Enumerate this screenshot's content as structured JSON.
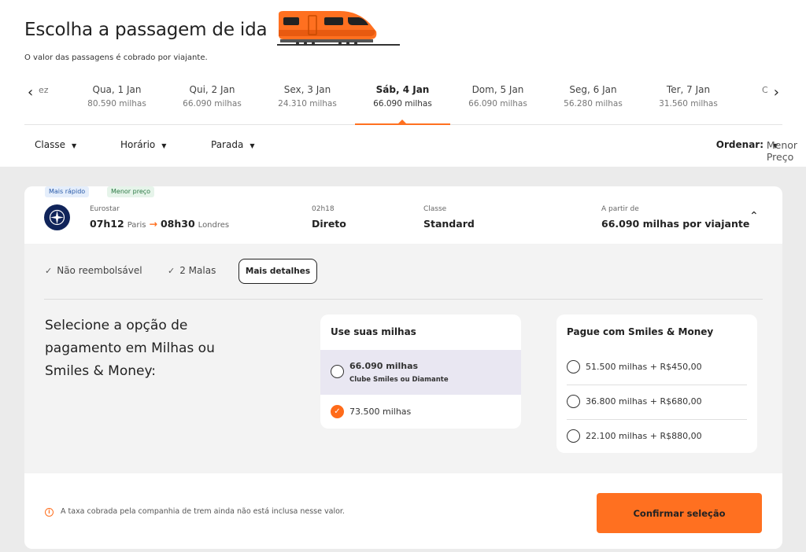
{
  "header": {
    "title": "Escolha a passagem de ida",
    "subtitle": "O valor das passagens é cobrado por viajante."
  },
  "dates": {
    "partial_left": "ez",
    "partial_right": "C",
    "items": [
      {
        "day": "Qua, 1 Jan",
        "miles": "80.590 milhas"
      },
      {
        "day": "Qui, 2 Jan",
        "miles": "66.090 milhas"
      },
      {
        "day": "Sex, 3 Jan",
        "miles": "24.310 milhas"
      },
      {
        "day": "Sáb, 4 Jan",
        "miles": "66.090 milhas",
        "selected": true
      },
      {
        "day": "Dom, 5 Jan",
        "miles": "66.090 milhas"
      },
      {
        "day": "Seg, 6 Jan",
        "miles": "56.280 milhas"
      },
      {
        "day": "Ter, 7 Jan",
        "miles": "31.560 milhas"
      }
    ]
  },
  "filters": {
    "class_label": "Classe",
    "time_label": "Horário",
    "stop_label": "Parada",
    "sort_label": "Ordenar:",
    "sort_value": "Menor Preço"
  },
  "trip": {
    "tags": [
      "Mais rápido",
      "Menor preço"
    ],
    "operator": "Eurostar",
    "depart_time": "07h12",
    "depart_city": "Paris",
    "arrive_time": "08h30",
    "arrive_city": "Londres",
    "duration": "02h18",
    "stops": "Direto",
    "class_label": "Classe",
    "class_value": "Standard",
    "price_label": "A partir de",
    "price_value": "66.090 milhas por viajante"
  },
  "features": {
    "refund": "Não reembolsável",
    "bags": "2 Malas",
    "details_button": "Mais detalhes"
  },
  "payment": {
    "prompt": "Selecione a opção de pagamento em Milhas ou Smiles & Money:",
    "miles_box": {
      "title": "Use suas milhas",
      "options": [
        {
          "label": "66.090 milhas",
          "sub": "Clube Smiles ou Diamante",
          "checked": false
        },
        {
          "label": "73.500 milhas",
          "checked": true
        }
      ]
    },
    "money_box": {
      "title": "Pague com Smiles & Money",
      "options": [
        {
          "label": "51.500 milhas + R$450,00"
        },
        {
          "label": "36.800 milhas + R$680,00"
        },
        {
          "label": "22.100 milhas + R$880,00"
        }
      ]
    }
  },
  "footer": {
    "info": "A taxa cobrada pela companhia de trem ainda não está inclusa nesse valor.",
    "confirm_button": "Confirmar seleção"
  },
  "colors": {
    "accent": "#ff7020",
    "logo_bg": "#10245a",
    "highlight": "#e9e7f2"
  }
}
